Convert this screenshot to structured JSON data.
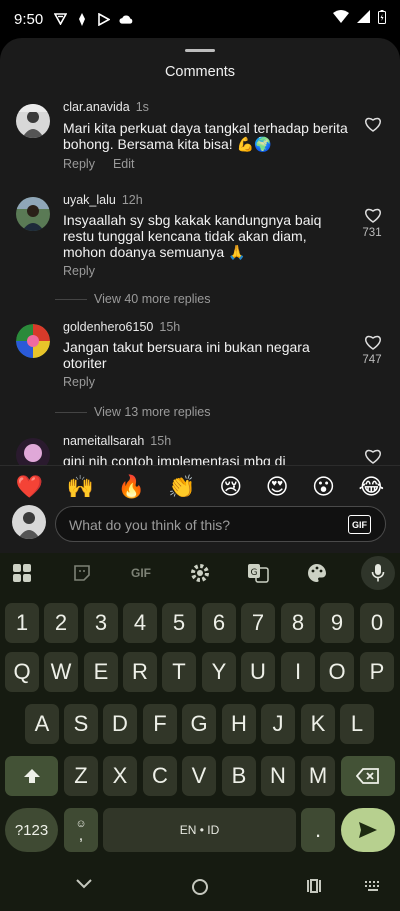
{
  "status": {
    "time": "9:50"
  },
  "sheet": {
    "title": "Comments"
  },
  "comments": [
    {
      "user": "clar.anavida",
      "time": "1s",
      "text": "Mari kita perkuat daya tangkal terhadap berita bohong. Bersama kita bisa! 💪🌍",
      "reply": "Reply",
      "edit": "Edit",
      "likes": ""
    },
    {
      "user": "uyak_lalu",
      "time": "12h",
      "text": "Insyaallah sy sbg kakak kandungnya baiq restu tunggal kencana tidak akan diam, mohon doanya semuanya 🙏",
      "reply": "Reply",
      "likes": "731",
      "more": "View 40 more replies"
    },
    {
      "user": "goldenhero6150",
      "time": "15h",
      "text": "Jangan takut bersuara ini bukan negara otoriter",
      "reply": "Reply",
      "likes": "747",
      "more": "View 13 more replies"
    },
    {
      "user": "nameitallsarah",
      "time": "15h",
      "text": "gini nih contoh implementasi mbg di"
    }
  ],
  "emojis": [
    "❤️",
    "🙌",
    "🔥",
    "👏",
    "😢",
    "😍",
    "😮",
    "😂"
  ],
  "input": {
    "placeholder": "What do you think of this?",
    "gif": "GIF"
  },
  "keyboard": {
    "toolbar": {
      "gif": "GIF"
    },
    "row_numbers": [
      "1",
      "2",
      "3",
      "4",
      "5",
      "6",
      "7",
      "8",
      "9",
      "0"
    ],
    "row1": [
      "Q",
      "W",
      "E",
      "R",
      "T",
      "Y",
      "U",
      "I",
      "O",
      "P"
    ],
    "row2": [
      "A",
      "S",
      "D",
      "F",
      "G",
      "H",
      "J",
      "K",
      "L"
    ],
    "row3": [
      "Z",
      "X",
      "C",
      "V",
      "B",
      "N",
      "M"
    ],
    "symbols": "?123",
    "comma": ",",
    "space": "EN • ID",
    "period": "."
  }
}
